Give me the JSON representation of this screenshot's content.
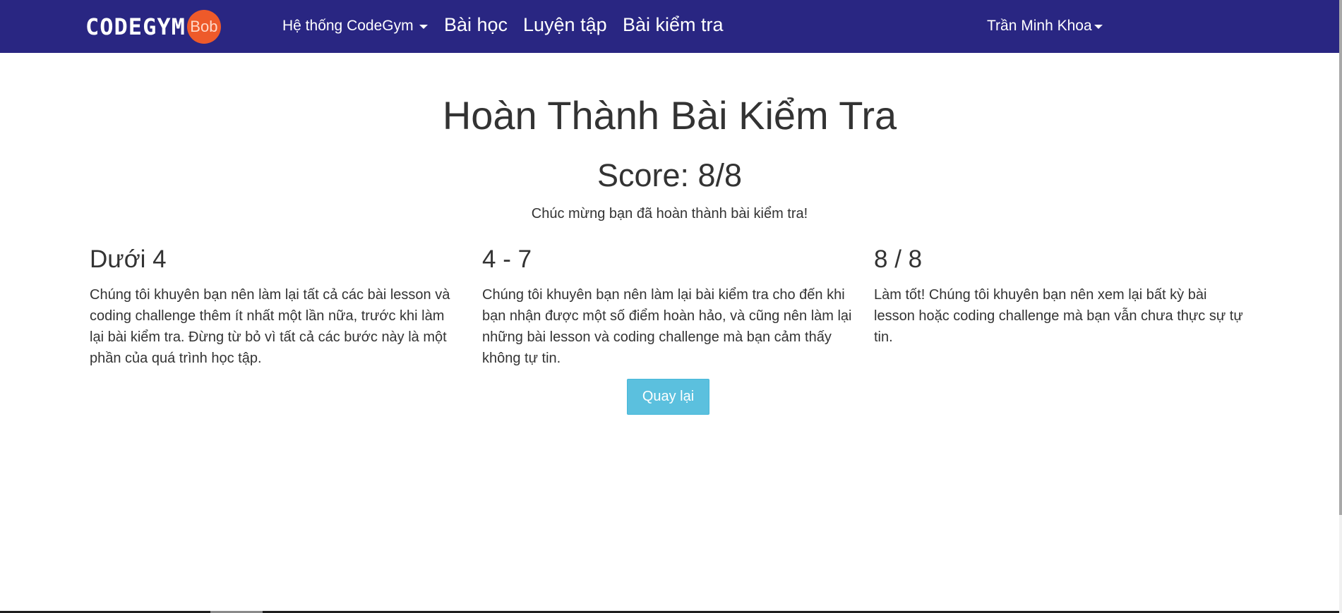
{
  "navbar": {
    "logo_text": "CODEGYM",
    "logo_badge": "Bob",
    "system_menu_label": "Hệ thống CodeGym",
    "lessons_label": "Bài học",
    "practice_label": "Luyện tập",
    "tests_label": "Bài kiểm tra",
    "user_name": "Trần Minh Khoa"
  },
  "main": {
    "title": "Hoàn Thành Bài Kiểm Tra",
    "score_text": "Score: 8/8",
    "congrats_text": "Chúc mừng bạn đã hoàn thành bài kiểm tra!",
    "columns": [
      {
        "heading": "Dưới 4",
        "text": "Chúng tôi khuyên bạn nên làm lại tất cả các bài lesson và coding challenge thêm ít nhất một lần nữa, trước khi làm lại bài kiểm tra. Đừng từ bỏ vì tất cả các bước này là một phần của quá trình học tập."
      },
      {
        "heading": "4 - 7",
        "text": "Chúng tôi khuyên bạn nên làm lại bài kiểm tra cho đến khi bạn nhận được một số điểm hoàn hảo, và cũng nên làm lại những bài lesson và coding challenge mà bạn cảm thấy không tự tin."
      },
      {
        "heading": "8 / 8",
        "text": "Làm tốt! Chúng tôi khuyên bạn nên xem lại bất kỳ bài lesson hoặc coding challenge mà bạn vẫn chưa thực sự tự tin."
      }
    ],
    "back_button_label": "Quay lại"
  },
  "colors": {
    "navbar_bg": "#292682",
    "logo_badge": "#ee5a2a",
    "button_info": "#5bc0de",
    "text": "#333333"
  }
}
